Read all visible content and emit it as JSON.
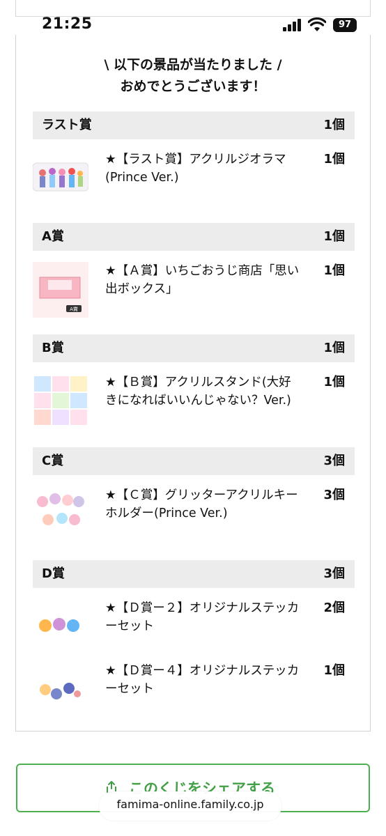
{
  "status": {
    "time": "21:25",
    "battery": "97"
  },
  "heading": {
    "line1": "\\ 以下の景品が当たりました /",
    "line2": "おめでとうございます！"
  },
  "groups": [
    {
      "name": "ラスト賞",
      "qty": "1個",
      "items": [
        {
          "name": "★【ラスト賞】アクリルジオラマ(Prince Ver.)",
          "qty": "1個"
        }
      ]
    },
    {
      "name": "A賞",
      "qty": "1個",
      "items": [
        {
          "name": "★【Ａ賞】いちごおうじ商店「思い出ボックス」",
          "qty": "1個"
        }
      ]
    },
    {
      "name": "B賞",
      "qty": "1個",
      "items": [
        {
          "name": "★【Ｂ賞】アクリルスタンド(大好きになればいいんじゃない？Ver.)",
          "qty": "1個"
        }
      ]
    },
    {
      "name": "C賞",
      "qty": "3個",
      "items": [
        {
          "name": "★【Ｃ賞】グリッターアクリルキーホルダー(Prince Ver.)",
          "qty": "3個"
        }
      ]
    },
    {
      "name": "D賞",
      "qty": "3個",
      "items": [
        {
          "name": "★【Ｄ賞ー２】オリジナルステッカーセット",
          "qty": "2個"
        },
        {
          "name": "★【Ｄ賞ー４】オリジナルステッカーセット",
          "qty": "1個"
        }
      ]
    }
  ],
  "thumb_labels": {
    "a_badge": "A賞"
  },
  "share": {
    "label": "このくじをシェアする"
  },
  "browser": {
    "url": "famima-online.family.co.jp"
  },
  "colors": {
    "accent": "#4caf50",
    "header_bg": "#ececec"
  }
}
